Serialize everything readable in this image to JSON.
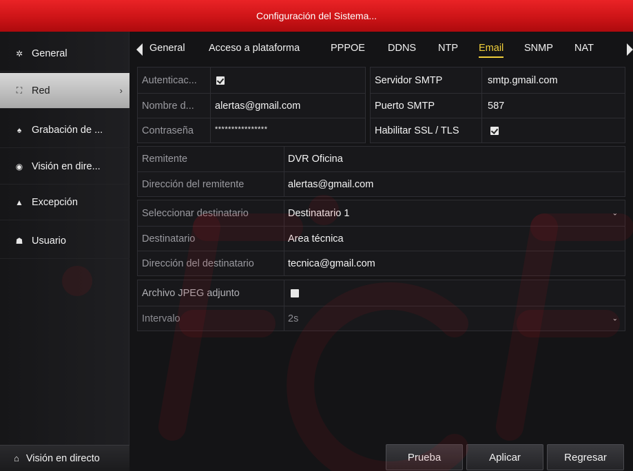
{
  "window": {
    "title": "Configuración del Sistema..."
  },
  "sidebar": {
    "items": [
      {
        "label": "General",
        "icon": "gear-icon"
      },
      {
        "label": "Red",
        "icon": "network-icon",
        "active": true
      },
      {
        "label": "Grabación de ...",
        "icon": "record-icon"
      },
      {
        "label": "Visión en dire...",
        "icon": "eye-icon"
      },
      {
        "label": "Excepción",
        "icon": "warning-icon"
      },
      {
        "label": "Usuario",
        "icon": "users-icon"
      }
    ],
    "bottom": {
      "label": "Visión en directo",
      "icon": "home-icon"
    }
  },
  "tabs": [
    {
      "label": "General"
    },
    {
      "label": "Acceso a plataforma"
    },
    {
      "label": "PPPOE"
    },
    {
      "label": "DDNS"
    },
    {
      "label": "NTP"
    },
    {
      "label": "Email",
      "active": true
    },
    {
      "label": "SNMP"
    },
    {
      "label": "NAT"
    }
  ],
  "form": {
    "auth": {
      "label": "Autenticac...",
      "checked": true
    },
    "username": {
      "label": "Nombre d...",
      "value": "alertas@gmail.com"
    },
    "password": {
      "label": "Contraseña",
      "value": "****************"
    },
    "smtp_server": {
      "label": "Servidor SMTP",
      "value": "smtp.gmail.com"
    },
    "smtp_port": {
      "label": "Puerto SMTP",
      "value": "587"
    },
    "ssl": {
      "label": "Habilitar SSL / TLS",
      "checked": true
    },
    "sender": {
      "label": "Remitente",
      "value": "DVR Oficina"
    },
    "sender_address": {
      "label": "Dirección del remitente",
      "value": "alertas@gmail.com"
    },
    "select_recipient": {
      "label": "Seleccionar destinatario",
      "value": "Destinatario 1"
    },
    "recipient": {
      "label": "Destinatario",
      "value": "Area técnica"
    },
    "recipient_address": {
      "label": "Dirección del destinatario",
      "value": "tecnica@gmail.com"
    },
    "jpeg": {
      "label": "Archivo JPEG adjunto",
      "checked": false
    },
    "interval": {
      "label": "Intervalo",
      "value": "2s"
    }
  },
  "buttons": {
    "test": "Prueba",
    "apply": "Aplicar",
    "back": "Regresar"
  },
  "colors": {
    "titlebar": "#cd1417",
    "active_tab": "#f2d03b",
    "watermark": "#c0121a"
  }
}
